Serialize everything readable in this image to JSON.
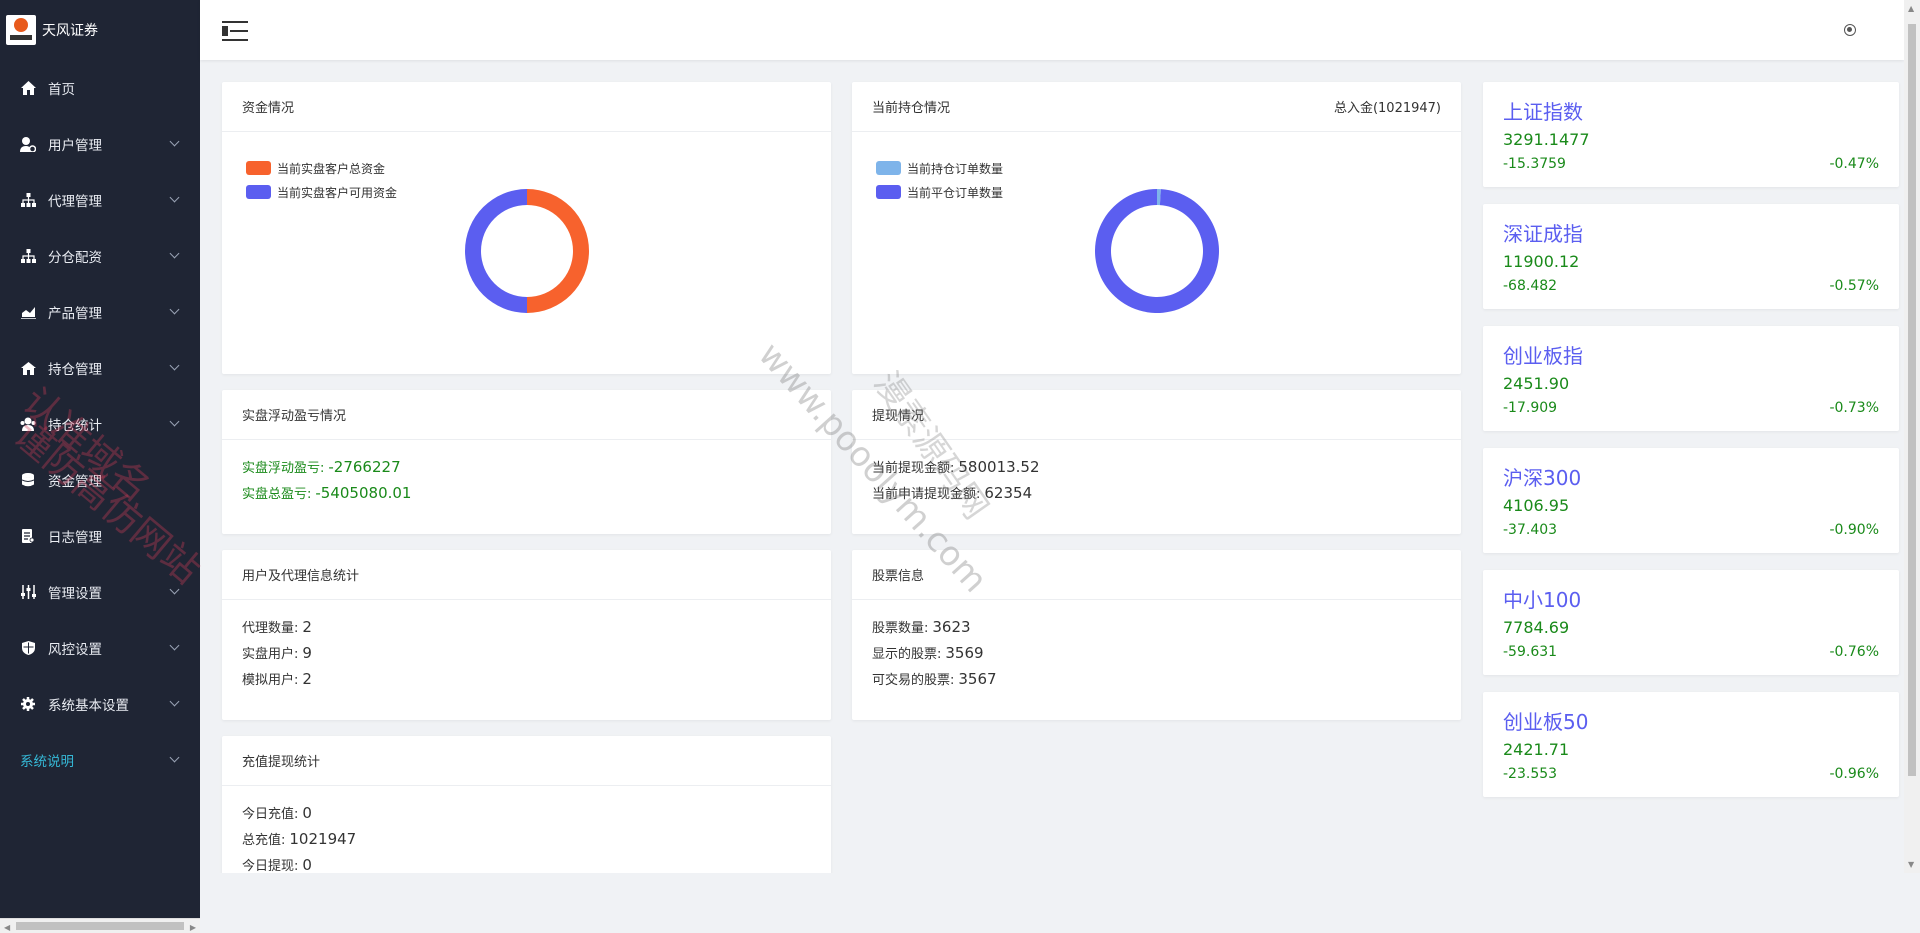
{
  "app": {
    "logo_text": "天风证券"
  },
  "sidebar": {
    "items": [
      {
        "label": "首页",
        "icon": "home-icon",
        "has_sub": false
      },
      {
        "label": "用户管理",
        "icon": "user-gear-icon",
        "has_sub": true
      },
      {
        "label": "代理管理",
        "icon": "sitemap-icon",
        "has_sub": true
      },
      {
        "label": "分仓配资",
        "icon": "sitemap-icon",
        "has_sub": true
      },
      {
        "label": "产品管理",
        "icon": "chart-icon",
        "has_sub": true
      },
      {
        "label": "持仓管理",
        "icon": "house-icon",
        "has_sub": true
      },
      {
        "label": "持仓统计",
        "icon": "users-icon",
        "has_sub": true
      },
      {
        "label": "资金管理",
        "icon": "database-icon",
        "has_sub": false
      },
      {
        "label": "日志管理",
        "icon": "log-icon",
        "has_sub": false
      },
      {
        "label": "管理设置",
        "icon": "sliders-icon",
        "has_sub": true
      },
      {
        "label": "风控设置",
        "icon": "shield-icon",
        "has_sub": true
      },
      {
        "label": "系统基本设置",
        "icon": "gear-icon",
        "has_sub": true
      }
    ],
    "system_note": "系统说明"
  },
  "cards": {
    "funds": {
      "title": "资金情况",
      "legend": [
        {
          "label": "当前实盘客户总资金",
          "color": "#f7622d"
        },
        {
          "label": "当前实盘客户可用资金",
          "color": "#5b5ef0"
        }
      ],
      "donut": [
        0.5,
        0.5
      ]
    },
    "positions": {
      "title": "当前持仓情况",
      "right": "总入金(1021947)",
      "legend": [
        {
          "label": "当前持仓订单数量",
          "color": "#7eb4ea"
        },
        {
          "label": "当前平仓订单数量",
          "color": "#5b5ef0"
        }
      ],
      "donut": [
        0.01,
        0.99
      ]
    },
    "pnl": {
      "title": "实盘浮动盈亏情况",
      "rows": [
        {
          "label": "实盘浮动盈亏:",
          "value": "-2766227"
        },
        {
          "label": "实盘总盈亏:",
          "value": "-5405080.01"
        }
      ]
    },
    "withdraw": {
      "title": "提现情况",
      "rows": [
        {
          "label": "当前提现金额:",
          "value": "580013.52"
        },
        {
          "label": "当前申请提现金额:",
          "value": "62354"
        }
      ]
    },
    "users": {
      "title": "用户及代理信息统计",
      "rows": [
        {
          "label": "代理数量:",
          "value": "2"
        },
        {
          "label": "实盘用户:",
          "value": "9"
        },
        {
          "label": "模拟用户:",
          "value": "2"
        }
      ]
    },
    "stocks": {
      "title": "股票信息",
      "rows": [
        {
          "label": "股票数量:",
          "value": "3623"
        },
        {
          "label": "显示的股票:",
          "value": "3569"
        },
        {
          "label": "可交易的股票:",
          "value": "3567"
        }
      ]
    },
    "recharge": {
      "title": "充值提现统计",
      "rows": [
        {
          "label": "今日充值:",
          "value": "0"
        },
        {
          "label": "总充值:",
          "value": "1021947"
        },
        {
          "label": "今日提现:",
          "value": "0"
        }
      ]
    }
  },
  "indices": [
    {
      "name": "上证指数",
      "price": "3291.1477",
      "change": "-15.3759",
      "pct": "-0.47%"
    },
    {
      "name": "深证成指",
      "price": "11900.12",
      "change": "-68.482",
      "pct": "-0.57%"
    },
    {
      "name": "创业板指",
      "price": "2451.90",
      "change": "-17.909",
      "pct": "-0.73%"
    },
    {
      "name": "沪深300",
      "price": "4106.95",
      "change": "-37.403",
      "pct": "-0.90%"
    },
    {
      "name": "中小100",
      "price": "7784.69",
      "change": "-59.631",
      "pct": "-0.76%"
    },
    {
      "name": "创业板50",
      "price": "2421.71",
      "change": "-23.553",
      "pct": "-0.96%"
    }
  ],
  "watermarks": {
    "left_1": "认准域名",
    "left_2": "谨防高仿网站",
    "center_url": "www.pooolym.com",
    "center_cn": "漫素源码网"
  }
}
